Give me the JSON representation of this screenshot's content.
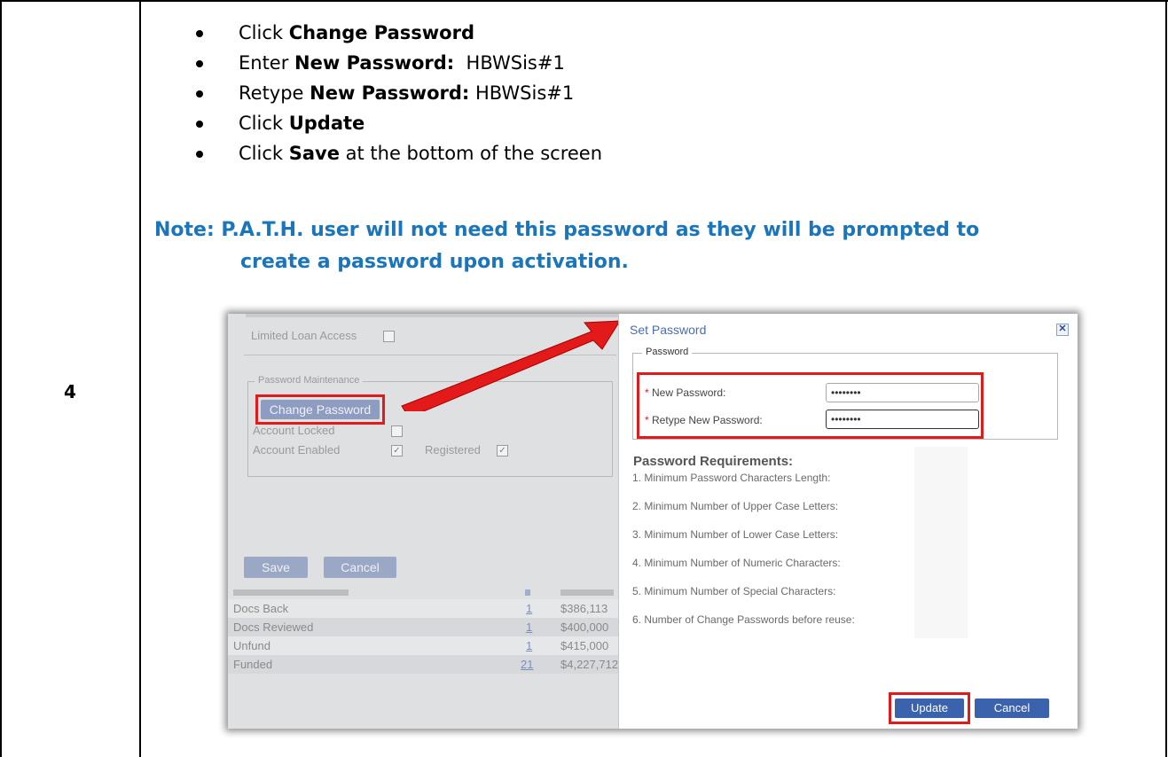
{
  "step": "4",
  "instructions": [
    {
      "prefix": "Click ",
      "bold": "Change Password",
      "suffix": ""
    },
    {
      "prefix": "Enter ",
      "bold": "New Password:",
      "suffix": "  HBWSis#1"
    },
    {
      "prefix": "Retype ",
      "bold": "New Password:",
      "suffix": " HBWSis#1"
    },
    {
      "prefix": "Click ",
      "bold": "Update",
      "suffix": ""
    },
    {
      "prefix": "Click ",
      "bold": "Save",
      "suffix": " at the bottom of the screen"
    }
  ],
  "note": {
    "line1": "Note:  P.A.T.H. user will not need this password as they will be prompted to",
    "line2": "create a password upon activation.",
    "color": "#1b75bb"
  },
  "screenshot": {
    "background_form": {
      "limited_loan_access_label": "Limited Loan Access",
      "password_maintenance_legend": "Password Maintenance",
      "change_password_button": "Change Password",
      "account_locked_label": "Account Locked",
      "account_enabled_label": "Account Enabled",
      "registered_label": "Registered",
      "save_button": "Save",
      "cancel_button": "Cancel",
      "rows": [
        {
          "label": "Docs Back",
          "count": "1",
          "amount": "$386,113"
        },
        {
          "label": "Docs Reviewed",
          "count": "1",
          "amount": "$400,000"
        },
        {
          "label": "Unfund",
          "count": "1",
          "amount": "$415,000"
        },
        {
          "label": "Funded",
          "count": "21",
          "amount": "$4,227,712"
        }
      ]
    },
    "dialog": {
      "title": "Set Password",
      "close_icon": "close-x-icon",
      "password_legend": "Password",
      "new_password_label": "New Password:",
      "retype_password_label": "Retype New Password:",
      "new_password_value": "••••••••",
      "retype_password_value": "••••••••",
      "requirements_title": "Password Requirements:",
      "requirements": [
        "1. Minimum Password Characters Length:",
        "2. Minimum Number of Upper Case Letters:",
        "3. Minimum Number of Lower Case Letters:",
        "4. Minimum Number of Numeric Characters:",
        "5. Minimum Number of Special Characters:",
        "6. Number of Change Passwords before reuse:"
      ],
      "update_button": "Update",
      "cancel_button": "Cancel"
    },
    "highlight_color": "#e01b1b"
  }
}
